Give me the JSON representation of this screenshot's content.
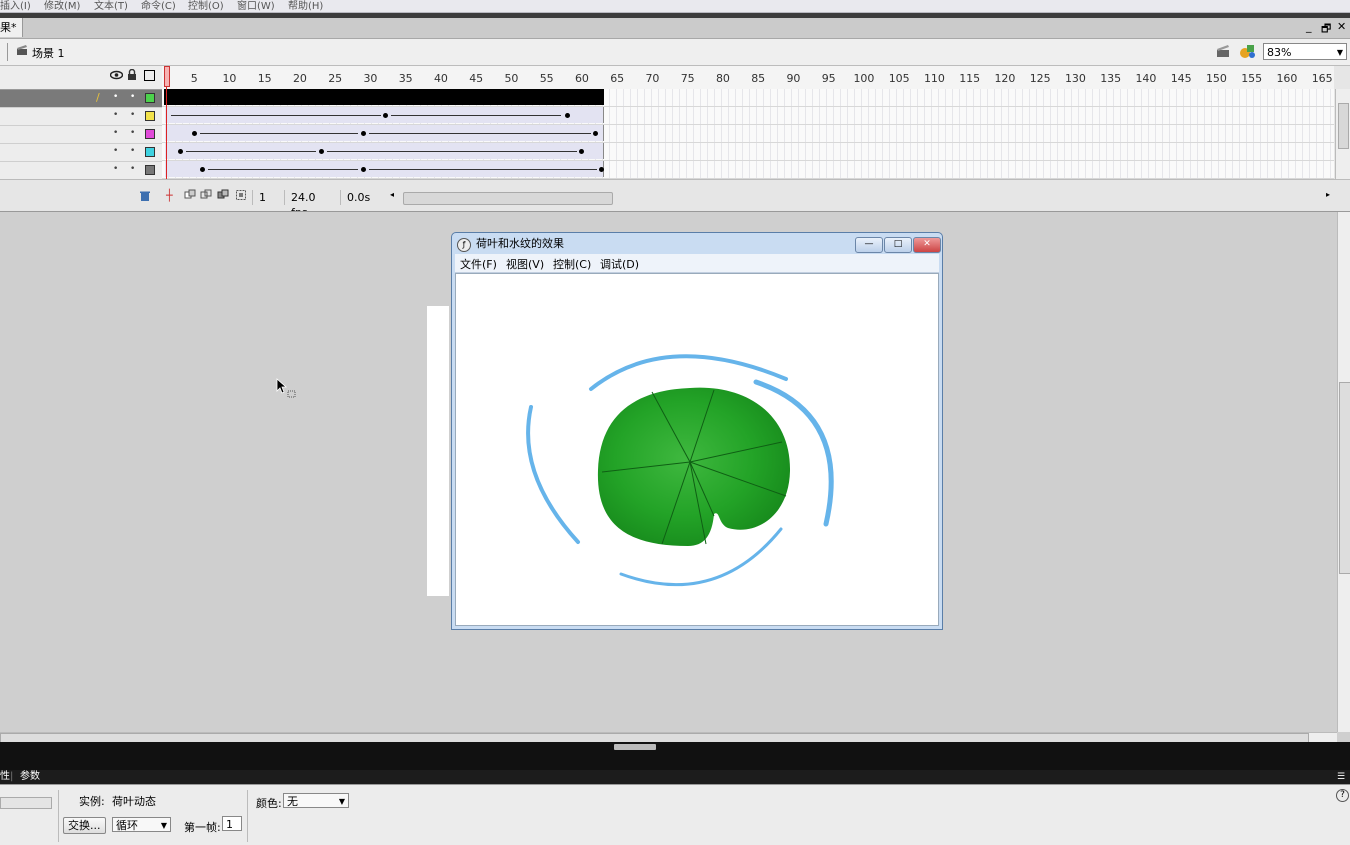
{
  "menubar": {
    "items": [
      "插入(I)",
      "修改(M)",
      "文本(T)",
      "命令(C)",
      "控制(O)",
      "窗口(W)",
      "帮助(H)"
    ]
  },
  "document": {
    "tab_label": "果*",
    "win_min": "_",
    "win_restore": "🗗",
    "win_close": "✕"
  },
  "scene": {
    "name": "场景 1",
    "zoom": "83%"
  },
  "timeline": {
    "ruler_ticks": [
      "1",
      "5",
      "10",
      "15",
      "20",
      "25",
      "30",
      "35",
      "40",
      "45",
      "50",
      "55",
      "60",
      "65",
      "70",
      "75",
      "80",
      "85",
      "90",
      "95",
      "100",
      "105",
      "110",
      "115",
      "120",
      "125",
      "130",
      "135",
      "140",
      "145",
      "150",
      "155",
      "160",
      "165"
    ],
    "layer_colors": [
      "#4cd24c",
      "#f2e24a",
      "#e04ad8",
      "#3fd2e0",
      "#777777"
    ],
    "current_frame": "1",
    "fps": "24.0 fps",
    "elapsed": "0.0s"
  },
  "player": {
    "title": "荷叶和水纹的效果",
    "menu": [
      "文件(F)",
      "视图(V)",
      "控制(C)",
      "调试(D)"
    ],
    "btn_min": "—",
    "btn_max": "□",
    "btn_close": "✕"
  },
  "panel": {
    "tab_left": "性",
    "tab_params": "参数"
  },
  "properties": {
    "instance_label": "实例:",
    "instance_name": "荷叶动态",
    "swap_button": "交换...",
    "loop_mode": "循环",
    "first_frame_label": "第一帧:",
    "first_frame_value": "1",
    "color_label": "颜色:",
    "color_value": "无",
    "help": "?"
  }
}
